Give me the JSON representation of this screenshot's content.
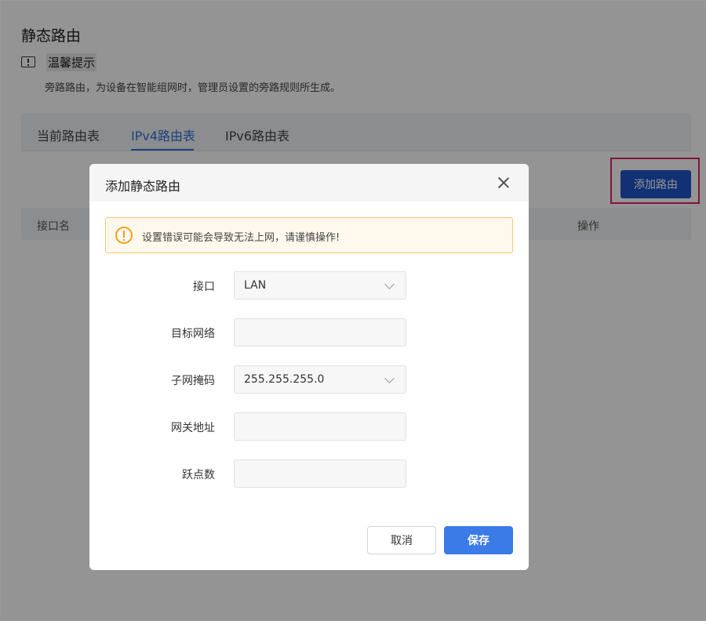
{
  "page": {
    "title": "静态路由",
    "tip_title": "温馨提示",
    "tip_desc": "旁路路由，为设备在智能组网时，管理员设置的旁路规则所生成。"
  },
  "tabs": [
    {
      "label": "当前路由表",
      "active": false
    },
    {
      "label": "IPv4路由表",
      "active": true
    },
    {
      "label": "IPv6路由表",
      "active": false
    }
  ],
  "toolbar": {
    "add_route_label": "添加路由"
  },
  "table": {
    "headers": [
      "接口名",
      "操作"
    ]
  },
  "modal": {
    "title": "添加静态路由",
    "warning": "设置错误可能会导致无法上网，请谨慎操作!",
    "fields": {
      "interface": {
        "label": "接口",
        "value": "LAN"
      },
      "target_network": {
        "label": "目标网络",
        "value": ""
      },
      "subnet_mask": {
        "label": "子网掩码",
        "value": "255.255.255.0"
      },
      "gateway": {
        "label": "网关地址",
        "value": ""
      },
      "hops": {
        "label": "跃点数",
        "value": ""
      }
    },
    "cancel_label": "取消",
    "save_label": "保存"
  },
  "colors": {
    "accent": "#1f55c8",
    "primary_button": "#3a7be8",
    "highlight_border": "#e0245e",
    "warning": "#f0a020"
  }
}
